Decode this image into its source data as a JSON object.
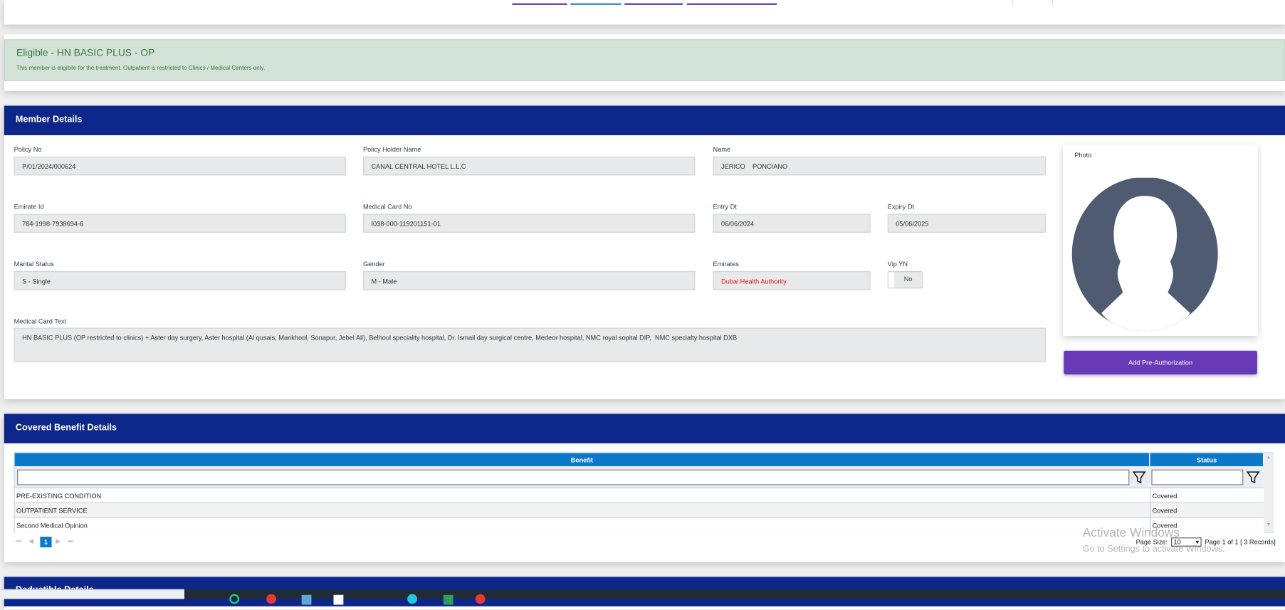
{
  "eligibility": {
    "title": "Eligible - HN BASIC PLUS - OP",
    "message": "This member is eligibile for the treatment. Outpatient is restricted to Clinics / Medical Centers only."
  },
  "member_details": {
    "title": "Member Details",
    "fields": {
      "policy_no": {
        "label": "Policy No",
        "value": "P/01/2024/000624"
      },
      "policy_holder": {
        "label": "Policy Holder Name",
        "value": "CANAL CENTRAL HOTEL L.L.C"
      },
      "name": {
        "label": "Name",
        "value": "JERICO    PONCIANO"
      },
      "emirate_id": {
        "label": "Emirate Id",
        "value": "784-1998-7938694-6"
      },
      "medical_card_no": {
        "label": "Medical Card No",
        "value": "I038-000-119201151-01"
      },
      "entry_dt": {
        "label": "Entry Dt",
        "value": "06/06/2024"
      },
      "expiry_dt": {
        "label": "Expiry Dt",
        "value": "05/06/2025"
      },
      "marital_status": {
        "label": "Marital Status",
        "value": "S - Single"
      },
      "gender": {
        "label": "Gender",
        "value": "M - Male"
      },
      "emirates": {
        "label": "Emirates",
        "value": "Dubai Health Authority"
      },
      "vip": {
        "label": "Vip YN",
        "value": "No"
      },
      "medical_card_text": {
        "label": "Medical Card Text",
        "value": "HN BASIC PLUS (OP restricted to clinics) + Aster day surgery, Aster hospital (Al qusais, Mankhool, Sonapur, Jebel Ali), Belhoul speciality hospital, Dr. Ismail day surgical centre, Medeor hospital, NMC royal sopital DIP,  NMC specialty hospital DXB"
      }
    },
    "photo_label": "Photo",
    "add_preauth_label": "Add Pre-Authorization"
  },
  "covered_benefits": {
    "title": "Covered Benefit Details",
    "columns": [
      "Benefit",
      "Status"
    ],
    "rows": [
      {
        "benefit": "PRE-EXISTING CONDITION",
        "status": "Covered"
      },
      {
        "benefit": "OUTPATIENT SERVICE",
        "status": "Covered"
      },
      {
        "benefit": "Second Medical Opinion",
        "status": "Covered"
      }
    ],
    "pager": {
      "current_page": "1",
      "page_size_label": "Page Size:",
      "page_size": "10",
      "page_info": "Page 1 of 1 [ 3 Records]"
    }
  },
  "deductible": {
    "title": "Deductible Details"
  },
  "watermark": {
    "line1": "Activate Windows",
    "line2": "Go to Settings to activate Windows."
  },
  "colors": {
    "navy": "#0d2689",
    "accent": "#673ab7",
    "grid_header": "#0b78c9",
    "eligible_bg": "#d4e3d8",
    "emirates_text": "#e8141c"
  }
}
